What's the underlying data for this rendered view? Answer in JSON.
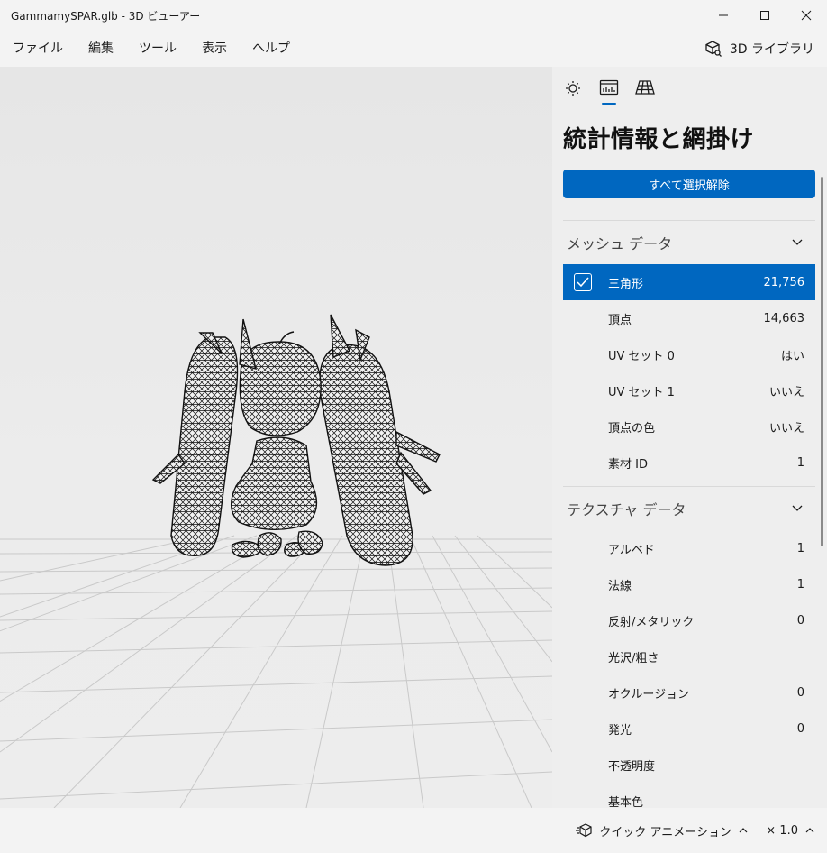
{
  "window": {
    "title": "GammamySPAR.glb - 3D ビューアー",
    "minimize": "—",
    "maximize": "☐",
    "close": "✕"
  },
  "menu": [
    "ファイル",
    "編集",
    "ツール",
    "表示",
    "ヘルプ"
  ],
  "library_label": "3D ライブラリ",
  "panel": {
    "tabs": [
      {
        "icon": "sun-icon",
        "active": false
      },
      {
        "icon": "stats-icon",
        "active": true
      },
      {
        "icon": "grid-icon",
        "active": false
      }
    ],
    "title": "統計情報と網掛け",
    "deselect_all": "すべて選択解除",
    "mesh_section": "メッシュ データ",
    "mesh_rows": [
      {
        "label": "三角形",
        "value": "21,756",
        "checked": true
      },
      {
        "label": "頂点",
        "value": "14,663"
      },
      {
        "label": "UV セット 0",
        "value": "はい"
      },
      {
        "label": "UV セット 1",
        "value": "いいえ"
      },
      {
        "label": "頂点の色",
        "value": "いいえ"
      },
      {
        "label": "素材 ID",
        "value": "1"
      }
    ],
    "texture_section": "テクスチャ データ",
    "texture_rows": [
      {
        "label": "アルベド",
        "value": "1"
      },
      {
        "label": "法線",
        "value": "1"
      },
      {
        "label": "反射/メタリック",
        "value": "0"
      },
      {
        "label": "光沢/粗さ",
        "value": ""
      },
      {
        "label": "オクルージョン",
        "value": "0"
      },
      {
        "label": "発光",
        "value": "0"
      },
      {
        "label": "不透明度",
        "value": ""
      },
      {
        "label": "基本色",
        "value": ""
      }
    ]
  },
  "status": {
    "animation_label": "クイック アニメーション",
    "speed_label": "× 1.0",
    "chevron": "^"
  },
  "colors": {
    "accent": "#0067c0",
    "background": "#f3f3f3",
    "panel": "#eeeeee",
    "viewport": "#e8e8e8"
  }
}
